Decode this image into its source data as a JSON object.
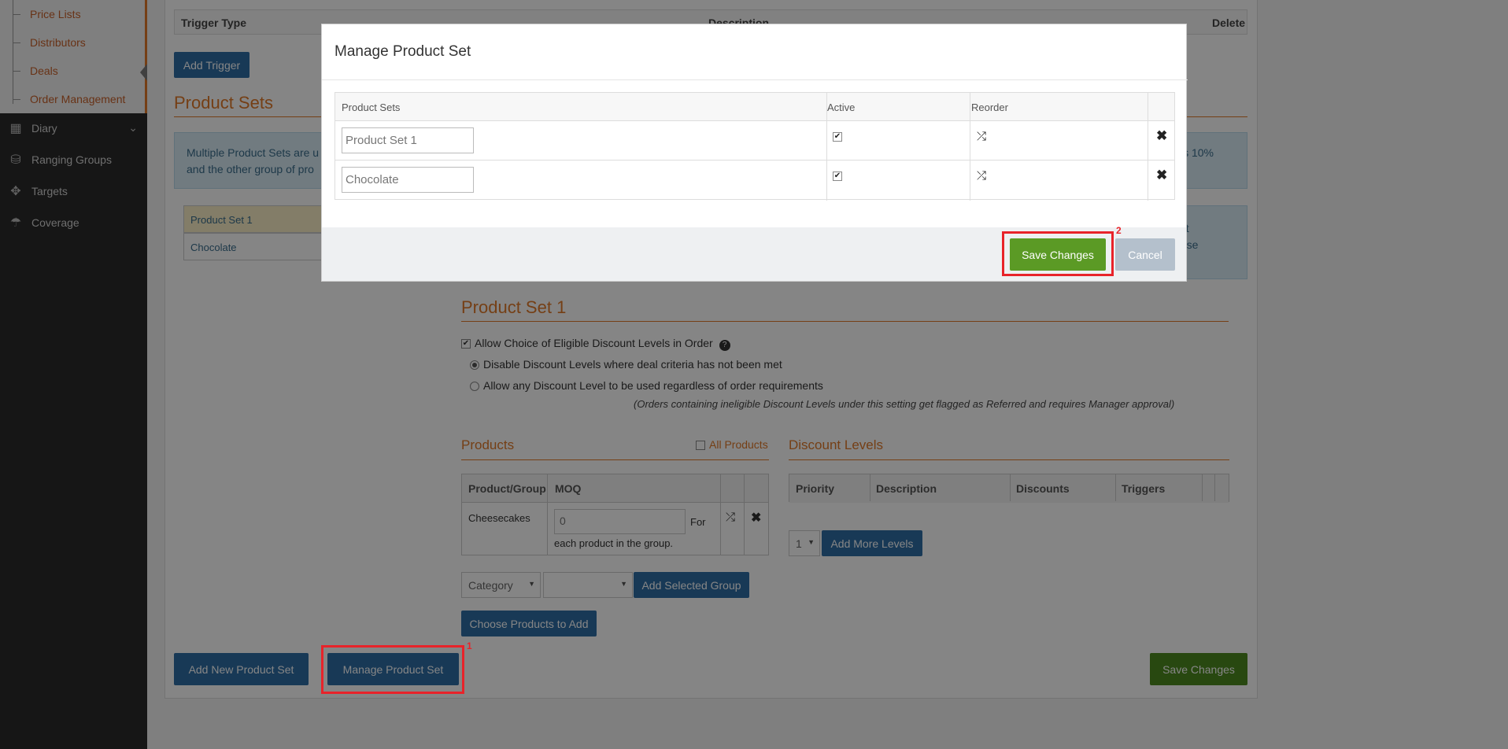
{
  "sidebar": {
    "sub_items": [
      "Price Lists",
      "Distributors",
      "Deals",
      "Order Management"
    ],
    "nav_items": [
      {
        "label": "Diary",
        "icon": "calendar-icon"
      },
      {
        "label": "Ranging Groups",
        "icon": "coins-icon"
      },
      {
        "label": "Targets",
        "icon": "crosshair-icon"
      },
      {
        "label": "Coverage",
        "icon": "umbrella-icon"
      }
    ]
  },
  "triggers": {
    "col_trigger_type": "Trigger Type",
    "col_description": "Description",
    "col_delete": "Delete",
    "add_button": "Add Trigger"
  },
  "product_sets": {
    "title": "Product Sets",
    "info_line1": "Multiple Product Sets are u",
    "info_line1_end": "s 10%",
    "info_line2": "and the other group of pro",
    "list": [
      "Product Set 1",
      "Chocolate"
    ],
    "right_box_line1": "est",
    "right_box_line2": "hose"
  },
  "detail": {
    "title": "Product Set 1",
    "allow_choice_label": "Allow Choice of Eligible Discount Levels in Order",
    "help_icon": "question-circle-icon",
    "radio_disable_label": "Disable Discount Levels where deal criteria has not been met",
    "radio_allow_label": "Allow any Discount Level to be used regardless of order requirements",
    "note": "(Orders containing ineligible Discount Levels under this setting get flagged as Referred and requires Manager approval)"
  },
  "products": {
    "title": "Products",
    "all_products_label": "All Products",
    "col_product_group": "Product/Group",
    "col_moq": "MOQ",
    "row_name": "Cheesecakes",
    "moq_value": "0",
    "moq_suffix": "For",
    "moq_suffix2": "each product in the group.",
    "category_select": "Category",
    "add_group_button": "Add Selected Group",
    "choose_button": "Choose Products to Add"
  },
  "discount_levels": {
    "title": "Discount Levels",
    "col_priority": "Priority",
    "col_description": "Description",
    "col_discounts": "Discounts",
    "col_triggers": "Triggers",
    "levels_select": "1",
    "add_levels_button": "Add More Levels"
  },
  "footer": {
    "add_new_button": "Add New Product Set",
    "manage_button": "Manage Product Set",
    "save_button": "Save Changes"
  },
  "modal": {
    "title": "Manage Product Set",
    "col_product_sets": "Product Sets",
    "col_active": "Active",
    "col_reorder": "Reorder",
    "rows": [
      {
        "name": "Product Set 1",
        "active": true
      },
      {
        "name": "Chocolate",
        "active": true
      }
    ],
    "save_button": "Save Changes",
    "cancel_button": "Cancel"
  },
  "annotations": {
    "label_1": "1",
    "label_2": "2",
    "color": "#e8232a"
  }
}
